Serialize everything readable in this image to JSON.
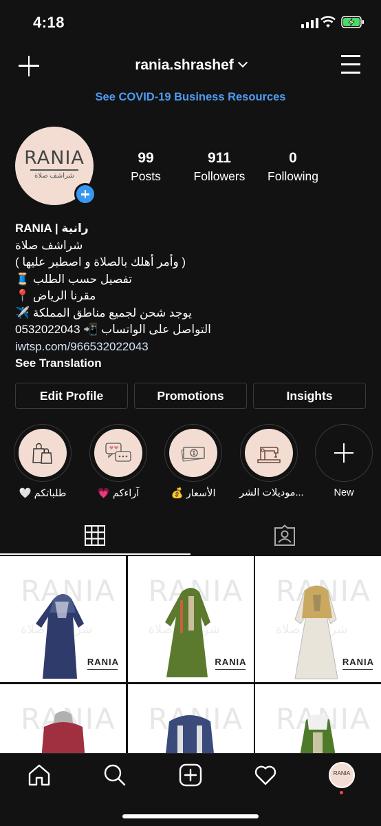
{
  "status": {
    "time": "4:18"
  },
  "header": {
    "username": "rania.shrashef"
  },
  "covid_banner": "See COVID-19 Business Resources",
  "profile": {
    "avatar_title": "RANIA",
    "avatar_subtitle": "شراشف صلاة",
    "stats": [
      {
        "num": "99",
        "label": "Posts"
      },
      {
        "num": "911",
        "label": "Followers"
      },
      {
        "num": "0",
        "label": "Following"
      }
    ]
  },
  "bio": {
    "name": "RANIA | رانية",
    "lines": [
      "شراشف صلاة",
      "( وأمر أهلك بالصلاة و اصطبر عليها )",
      "🧵 تفصيل حسب الطلب",
      "📍 مقرنا الرياض",
      "✈️ يوجد شحن لجميع مناطق المملكة",
      "0532022043 📲 التواصل على الواتساب"
    ],
    "link": "iwtsp.com/966532022043",
    "translation": "See Translation"
  },
  "buttons": {
    "edit": "Edit Profile",
    "promotions": "Promotions",
    "insights": "Insights"
  },
  "highlights": [
    {
      "label": "🤍 طلباتكم",
      "icon": "shopping-bags-icon"
    },
    {
      "label": "💗 آراءكم",
      "icon": "chat-bubbles-icon"
    },
    {
      "label": "💰 الأسعار",
      "icon": "money-icon"
    },
    {
      "label": "موديلات الشر...",
      "icon": "sewing-machine-icon"
    },
    {
      "label": "New",
      "icon": "plus-icon"
    }
  ],
  "posts": {
    "watermark": "RANIA",
    "watermark_sub": "شراشف صلاة",
    "brand": "RANIA",
    "items": [
      {
        "color": "#2f3b6b",
        "pattern": "#4a5a8a"
      },
      {
        "color": "#5c7a2e",
        "pattern": "#c86040"
      },
      {
        "color": "#e8e4da",
        "pattern": "#c9a860"
      },
      {
        "color": "#a03040",
        "pattern": "#b0b0b0"
      },
      {
        "color": "#3a4a7a",
        "pattern": "#e0e0e0"
      },
      {
        "color": "#4e7a2a",
        "pattern": "#f0f0f0"
      }
    ]
  },
  "colors": {
    "accent": "#4f9bf2",
    "background": "#121212",
    "brand_bg": "#f3ddd3"
  }
}
